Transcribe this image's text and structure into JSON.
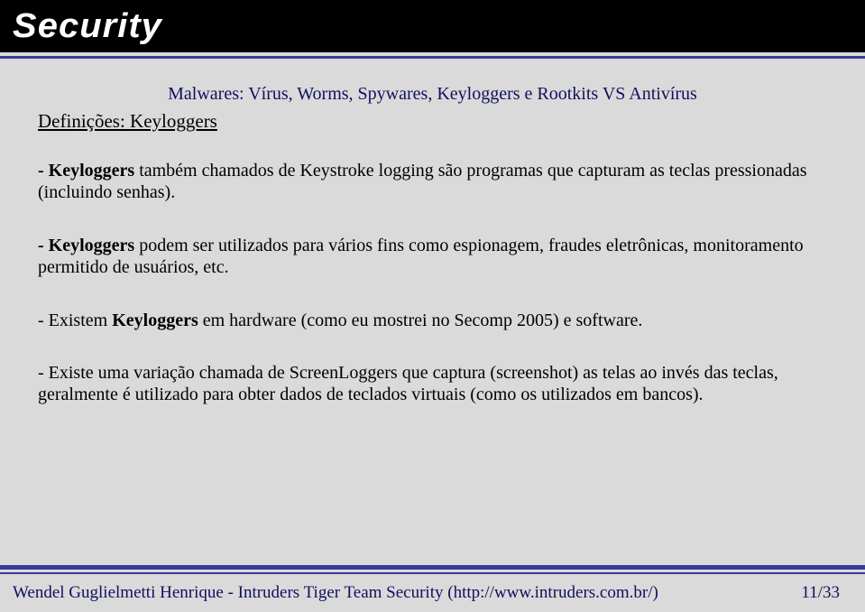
{
  "header": {
    "logo": "Security"
  },
  "title": "Malwares: Vírus, Worms, Spywares, Keyloggers e Rootkits VS Antivírus",
  "section_heading": "Definições: Keyloggers",
  "paragraphs": [
    {
      "lead": "- Keyloggers",
      "rest": " também chamados de Keystroke logging são programas que capturam as teclas pressionadas (incluindo senhas)."
    },
    {
      "lead": "- Keyloggers",
      "rest": " podem ser utilizados para vários fins como espionagem, fraudes eletrônicas, monitoramento permitido de usuários, etc."
    },
    {
      "lead": "",
      "rest_pre": "- Existem ",
      "bold_mid": "Keyloggers",
      "rest_post": " em hardware (como eu mostrei no Secomp 2005) e software."
    },
    {
      "lead": "",
      "rest": "- Existe uma variação chamada de ScreenLoggers que captura (screenshot) as telas ao invés das teclas, geralmente é utilizado para obter dados de teclados virtuais (como os utilizados em bancos)."
    }
  ],
  "footer": {
    "left": "Wendel Guglielmetti Henrique  -  Intruders Tiger Team Security  (http://www.intruders.com.br/)",
    "right": "11/33"
  }
}
